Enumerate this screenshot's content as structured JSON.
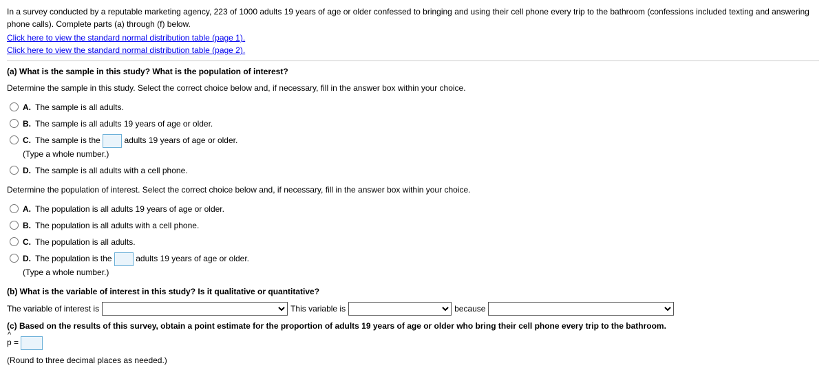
{
  "intro": {
    "text": "In a survey conducted by a reputable marketing agency, 223 of 1000 adults 19 years of age or older confessed to bringing and using their cell phone every trip to the bathroom (confessions included texting and answering phone calls). Complete parts (a) through (f) below.",
    "link1": "Click here to view the standard normal distribution table (page 1).",
    "link2": "Click here to view the standard normal distribution table (page 2)."
  },
  "part_a": {
    "prompt": "(a) What is the sample in this study? What is the population of interest?",
    "sample_instr": "Determine the sample in this study. Select the correct choice below and, if necessary, fill in the answer box within your choice.",
    "sample_options": {
      "A": "The sample is all adults.",
      "B": "The sample is all adults 19 years of age or older.",
      "C_pre": "The sample is the",
      "C_post": "adults 19 years of age or older.",
      "C_hint": "(Type a whole number.)",
      "D": "The sample is all adults with a cell phone."
    },
    "pop_instr": "Determine the population of interest. Select the correct choice below and, if necessary, fill in the answer box within your choice.",
    "pop_options": {
      "A": "The population is all adults 19 years of age or older.",
      "B": "The population is all adults with a cell phone.",
      "C": "The population is all adults.",
      "D_pre": "The population is the",
      "D_post": "adults 19 years of age or older.",
      "D_hint": "(Type a whole number.)"
    }
  },
  "part_b": {
    "prompt": "(b) What is the variable of interest in this study? Is it qualitative or quantitative?",
    "pre1": "The variable of interest is",
    "mid1": "This variable is",
    "mid2": "because"
  },
  "part_c": {
    "prompt": "(c) Based on the results of this survey, obtain a point estimate for the proportion of adults 19 years of age or older who bring their cell phone every trip to the bathroom.",
    "phat": "p =",
    "hint": "(Round to three decimal places as needed.)"
  },
  "labels": {
    "A": "A.",
    "B": "B.",
    "C": "C.",
    "D": "D."
  }
}
